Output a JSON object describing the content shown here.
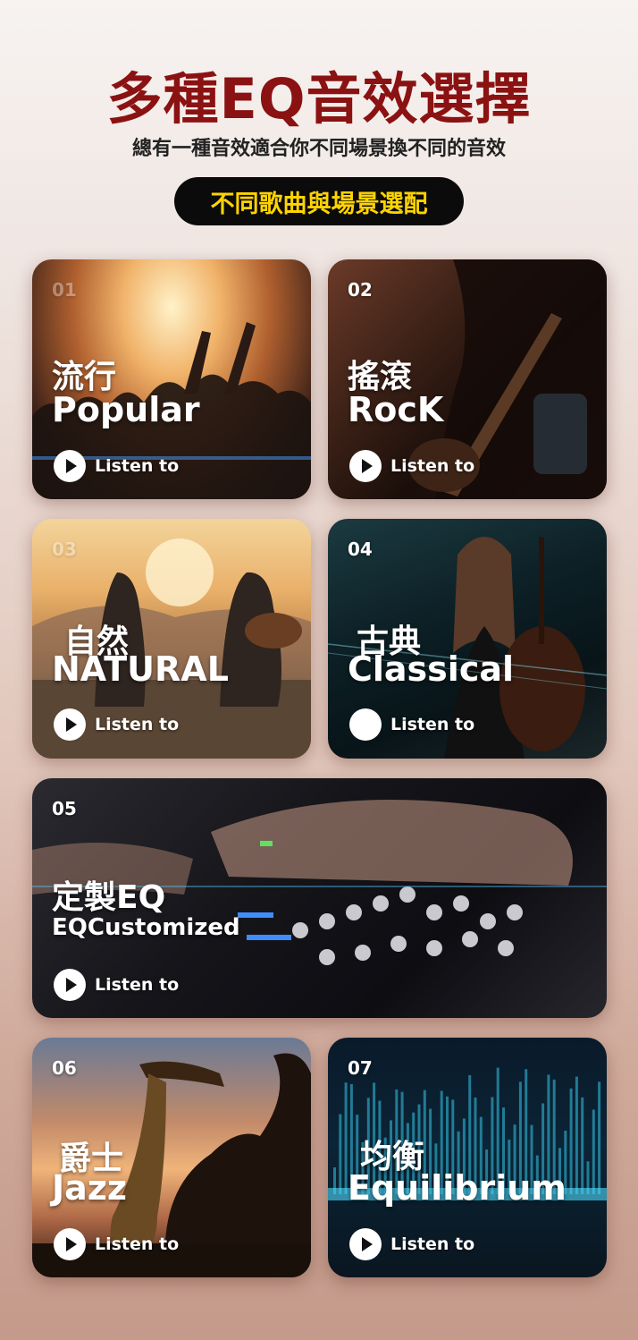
{
  "header": {
    "title": "多種EQ音效選擇",
    "subtitle": "總有一種音效適合你不同場景換不同的音效",
    "pill": "不同歌曲與場景選配"
  },
  "cards": [
    {
      "num": "01",
      "cn": "流行",
      "en": "Popular",
      "listen": "Listen to"
    },
    {
      "num": "02",
      "cn": "搖滾",
      "en": "RocK",
      "listen": "Listen to"
    },
    {
      "num": "03",
      "cn": "自然",
      "en": "NATURAL",
      "listen": "Listen to"
    },
    {
      "num": "04",
      "cn": "古典",
      "en": "Classical",
      "listen": "Listen to"
    },
    {
      "num": "05",
      "cn": "定製EQ",
      "en": "EQCustomized",
      "listen": "Listen to"
    },
    {
      "num": "06",
      "cn": "爵士",
      "en": "Jazz",
      "listen": "Listen to"
    },
    {
      "num": "07",
      "cn": "均衡",
      "en": "Equilibrium",
      "listen": "Listen to"
    }
  ],
  "colors": {
    "title": "#8b1212",
    "pill_text": "#ffd400",
    "pill_bg": "#0b0b0b"
  }
}
